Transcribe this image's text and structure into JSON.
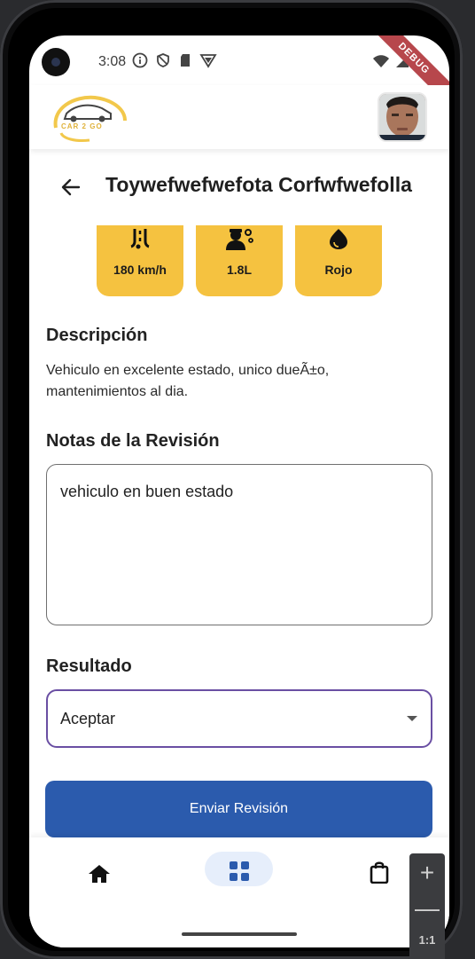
{
  "status_bar": {
    "time": "3:08",
    "debug_banner": "DEBUG"
  },
  "header": {
    "logo_text": "CAR 2 GO"
  },
  "page": {
    "title": "Toywefwefwefota Corfwfwefolla",
    "specs": [
      {
        "icon": "road-speed-icon",
        "value": "180 km/h"
      },
      {
        "icon": "engine-icon",
        "value": "1.8L"
      },
      {
        "icon": "color-drop-icon",
        "value": "Rojo"
      }
    ],
    "description_heading": "Descripción",
    "description_text": "Vehiculo en excelente estado, unico dueÃ±o, mantenimientos al dia.",
    "notes_heading": "Notas de la Revisión",
    "notes_value": "vehiculo en buen estado",
    "result_heading": "Resultado",
    "result_value": "Aceptar",
    "submit_label": "Enviar Revisión"
  },
  "zoom_panel": {
    "plus": "+",
    "minus": "—",
    "ratio": "1:1"
  },
  "colors": {
    "accent_yellow": "#f5c240",
    "primary_blue": "#2b5bad",
    "select_border": "#6a4fa3",
    "nav_pill": "#e6eefb"
  }
}
